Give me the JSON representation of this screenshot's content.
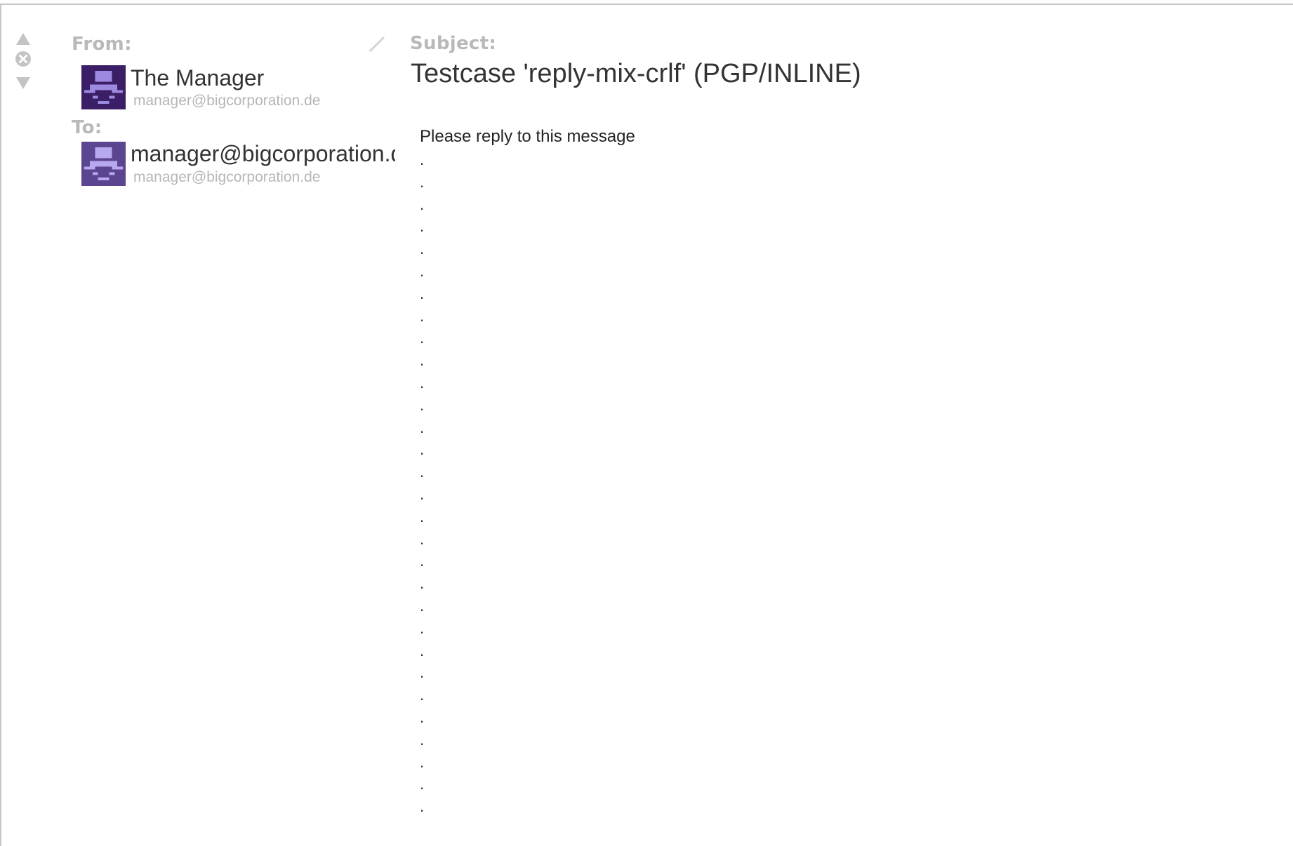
{
  "header": {
    "from_label": "From:",
    "to_label": "To:",
    "subject_label": "Subject:"
  },
  "from": {
    "name": "The Manager",
    "email": "manager@bigcorporation.de"
  },
  "to": {
    "name": "manager@bigcorporation.de",
    "email": "manager@bigcorporation.de"
  },
  "subject": "Testcase 'reply-mix-crlf' (PGP/INLINE)",
  "body": {
    "first_line": "Please reply to this message",
    "lines": [
      ".",
      ".",
      ".",
      ".",
      ".",
      ".",
      ".",
      ".",
      ".",
      ".",
      ".",
      ".",
      ".",
      ".",
      ".",
      ".",
      ".",
      ".",
      ".",
      ".",
      ".",
      ".",
      ".",
      ".",
      ".",
      ".",
      ".",
      ".",
      ".",
      "."
    ]
  },
  "colors": {
    "avatar_dark": "#3b1f66",
    "avatar_light": "#5b4591",
    "avatar_figure": "#9d8ae0",
    "label_gray": "#b9b9b9"
  },
  "icons": {
    "previous": "triangle-up-icon",
    "close": "circle-x-icon",
    "next": "triangle-down-icon",
    "edit": "pencil-icon",
    "from_avatar": "robot-avatar-icon",
    "to_avatar": "robot-avatar-icon"
  }
}
